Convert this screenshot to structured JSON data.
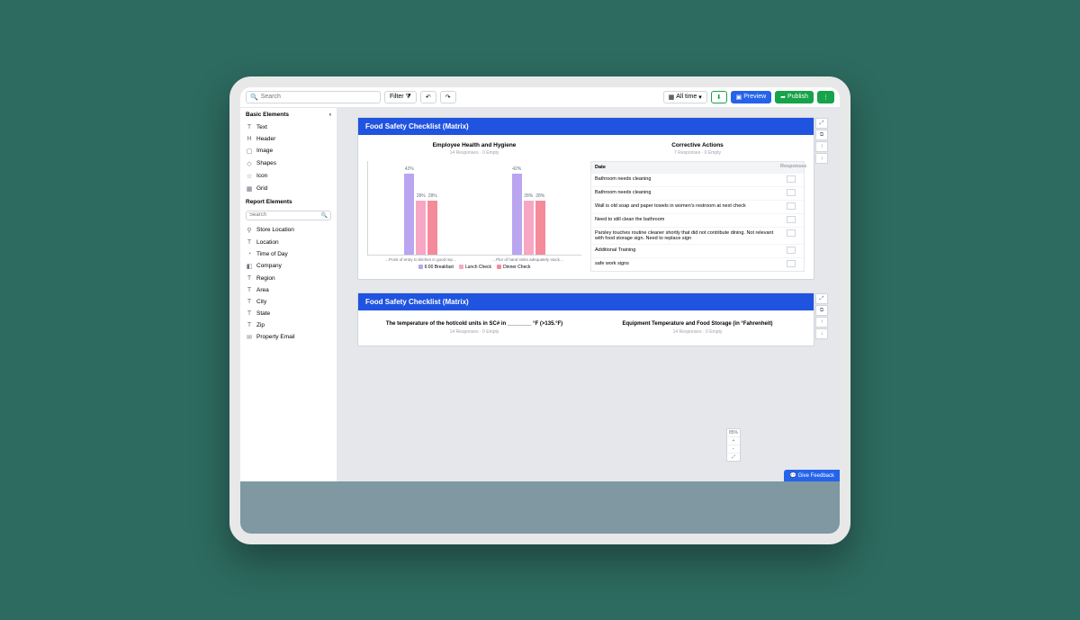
{
  "topbar": {
    "search_placeholder": "Search",
    "filter_label": "Filter",
    "timerange_label": "All time",
    "preview_label": "Preview",
    "publish_label": "Publish"
  },
  "sidebar": {
    "basic_title": "Basic Elements",
    "basic_items": [
      {
        "icon": "T",
        "label": "Text"
      },
      {
        "icon": "H",
        "label": "Header"
      },
      {
        "icon": "▢",
        "label": "Image"
      },
      {
        "icon": "◇",
        "label": "Shapes"
      },
      {
        "icon": "☆",
        "label": "Icon"
      },
      {
        "icon": "▦",
        "label": "Grid"
      }
    ],
    "report_title": "Report Elements",
    "report_search_placeholder": "Search",
    "report_items": [
      {
        "icon": "⚲",
        "label": "Store Location"
      },
      {
        "icon": "T",
        "label": "Location"
      },
      {
        "icon": "◔",
        "label": "Time of Day"
      },
      {
        "icon": "◧",
        "label": "Company"
      },
      {
        "icon": "T",
        "label": "Region"
      },
      {
        "icon": "T",
        "label": "Area"
      },
      {
        "icon": "T",
        "label": "City"
      },
      {
        "icon": "T",
        "label": "State"
      },
      {
        "icon": "T",
        "label": "Zip"
      },
      {
        "icon": "✉",
        "label": "Property Email"
      }
    ]
  },
  "card1": {
    "title": "Food Safety Checklist (Matrix)",
    "left": {
      "title": "Employee Health and Hygiene",
      "sub": "14 Responses · 0 Empty"
    },
    "right": {
      "title": "Corrective Actions",
      "sub": "7 Responses · 0 Empty"
    },
    "x_labels": [
      "…Point of entry to kitchen in good rep…",
      "…Plur of hand sinks adequately stock…"
    ],
    "legend": [
      "6:00 Breakfast",
      "Lunch Check",
      "Dinner Check"
    ],
    "table": {
      "head_date": "Date",
      "head_resp": "Responses",
      "rows": [
        "Bathroom needs cleaning",
        "Bathroom needs cleaning",
        "Wall is old soap and paper towels in women's restroom at next check",
        "Need to still clean the bathroom",
        "Parsley touches routine cleaner shortly that did not contribute dining. Not relevant with food storage sign. Need to replace sign",
        "Additional Training",
        "safe work signs"
      ]
    }
  },
  "card2": {
    "title": "Food Safety Checklist (Matrix)",
    "left": {
      "title": "The temperature of the hot/cold units in SC# in ________ °F (>135.°F)",
      "sub": "14 Responses · 0 Empty"
    },
    "right": {
      "title": "Equipment Temperature and Food Storage (in °Fahrenheit)",
      "sub": "14 Responses · 0 Empty"
    }
  },
  "feedback_label": "Give Feedback",
  "zoom": {
    "pct": "85%"
  },
  "chart_data": {
    "type": "bar",
    "title": "Employee Health and Hygiene",
    "categories": [
      "Point of entry to kitchen in good rep…",
      "Plur of hand sinks adequately stock…"
    ],
    "series": [
      {
        "name": "6:00 Breakfast",
        "color": "#b9a5f0",
        "values": [
          6,
          6
        ]
      },
      {
        "name": "Lunch Check",
        "color": "#f7a6c4",
        "values": [
          4,
          4
        ]
      },
      {
        "name": "Dinner Check",
        "color": "#f58a9b",
        "values": [
          4,
          4
        ]
      }
    ],
    "ylim": [
      0,
      7
    ],
    "bar_labels_pct": [
      [
        "42%",
        "28%",
        "28%"
      ],
      [
        "42%",
        "28%",
        "28%"
      ]
    ]
  }
}
